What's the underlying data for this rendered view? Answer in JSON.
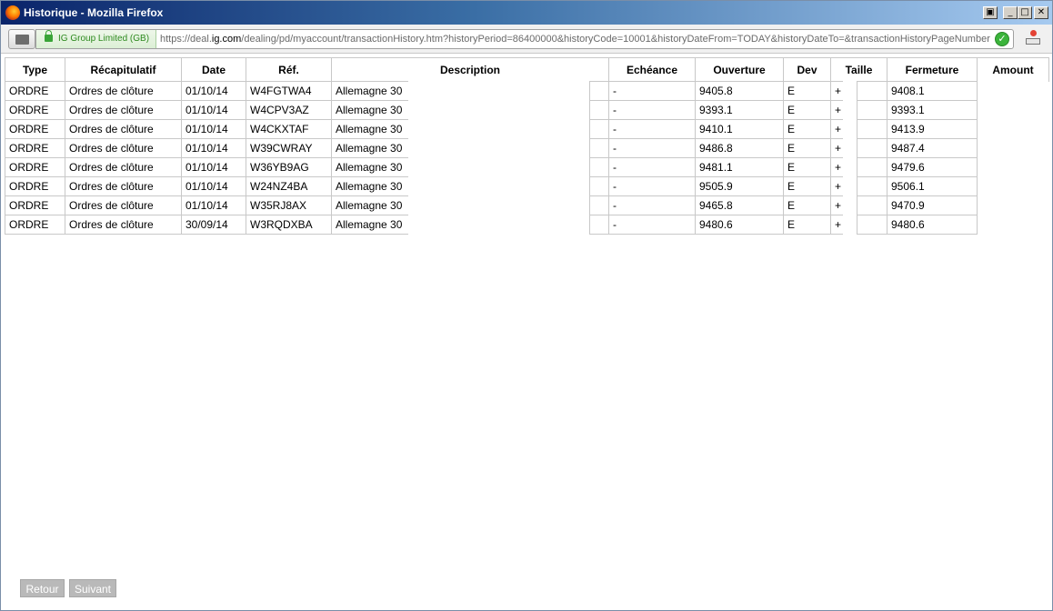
{
  "window": {
    "title": "Historique - Mozilla Firefox"
  },
  "urlbar": {
    "identity": "IG Group Limited (GB)",
    "url_prefix": "https://deal.",
    "url_domain": "ig.com",
    "url_suffix": "/dealing/pd/myaccount/transactionHistory.htm?historyPeriod=86400000&historyCode=10001&historyDateFrom=TODAY&historyDateTo=&transactionHistoryPageNumber"
  },
  "table": {
    "headers": {
      "type": "Type",
      "recap": "Récapitulatif",
      "date": "Date",
      "ref": "Réf.",
      "description": "Description",
      "echeance": "Echéance",
      "ouverture": "Ouverture",
      "dev": "Dev",
      "taille": "Taille",
      "fermeture": "Fermeture",
      "amount": "Amount"
    },
    "rows": [
      {
        "type": "ORDRE",
        "recap": "Ordres de clôture",
        "date": "01/10/14",
        "ref": "W4FGTWA4",
        "description": "Allemagne 30",
        "echeance": "-",
        "ouverture": "9405.8",
        "dev": "E",
        "taille": "+",
        "fermeture": "9408.1"
      },
      {
        "type": "ORDRE",
        "recap": "Ordres de clôture",
        "date": "01/10/14",
        "ref": "W4CPV3AZ",
        "description": "Allemagne 30",
        "echeance": "-",
        "ouverture": "9393.1",
        "dev": "E",
        "taille": "+",
        "fermeture": "9393.1"
      },
      {
        "type": "ORDRE",
        "recap": "Ordres de clôture",
        "date": "01/10/14",
        "ref": "W4CKXTAF",
        "description": "Allemagne 30",
        "echeance": "-",
        "ouverture": "9410.1",
        "dev": "E",
        "taille": "+",
        "fermeture": "9413.9"
      },
      {
        "type": "ORDRE",
        "recap": "Ordres de clôture",
        "date": "01/10/14",
        "ref": "W39CWRAY",
        "description": "Allemagne 30",
        "echeance": "-",
        "ouverture": "9486.8",
        "dev": "E",
        "taille": "+",
        "fermeture": "9487.4"
      },
      {
        "type": "ORDRE",
        "recap": "Ordres de clôture",
        "date": "01/10/14",
        "ref": "W36YB9AG",
        "description": "Allemagne 30",
        "echeance": "-",
        "ouverture": "9481.1",
        "dev": "E",
        "taille": "+",
        "fermeture": "9479.6"
      },
      {
        "type": "ORDRE",
        "recap": "Ordres de clôture",
        "date": "01/10/14",
        "ref": "W24NZ4BA",
        "description": "Allemagne 30",
        "echeance": "-",
        "ouverture": "9505.9",
        "dev": "E",
        "taille": "+",
        "fermeture": "9506.1"
      },
      {
        "type": "ORDRE",
        "recap": "Ordres de clôture",
        "date": "01/10/14",
        "ref": "W35RJ8AX",
        "description": "Allemagne 30",
        "echeance": "-",
        "ouverture": "9465.8",
        "dev": "E",
        "taille": "+",
        "fermeture": "9470.9"
      },
      {
        "type": "ORDRE",
        "recap": "Ordres de clôture",
        "date": "30/09/14",
        "ref": "W3RQDXBA",
        "description": "Allemagne 30",
        "echeance": "-",
        "ouverture": "9480.6",
        "dev": "E",
        "taille": "+",
        "fermeture": "9480.6"
      }
    ]
  },
  "pagination": {
    "prev_label": "Retour",
    "next_label": "Suivant"
  },
  "icons": {
    "app": "firefox-icon",
    "tab": "tab-groups-icon",
    "lock": "lock-icon",
    "verified": "check-icon",
    "addon": "addon-icon"
  }
}
